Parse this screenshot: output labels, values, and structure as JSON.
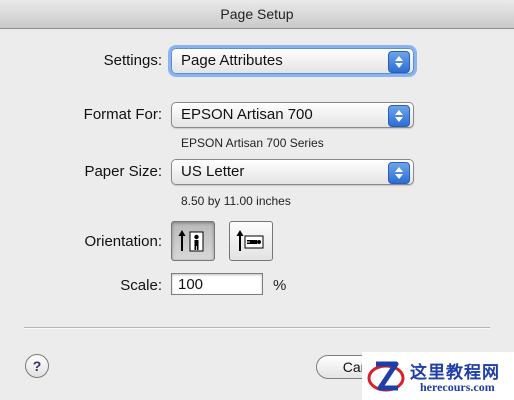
{
  "window": {
    "title": "Page Setup"
  },
  "settings": {
    "label": "Settings:",
    "value": "Page Attributes"
  },
  "format": {
    "label": "Format For:",
    "value": "EPSON Artisan 700",
    "description": "EPSON Artisan 700 Series"
  },
  "paper": {
    "label": "Paper Size:",
    "value": "US Letter",
    "description": "8.50 by 11.00 inches"
  },
  "orientation": {
    "label": "Orientation:",
    "selected": "portrait",
    "options": [
      "portrait-icon",
      "landscape-icon"
    ]
  },
  "scale": {
    "label": "Scale:",
    "value": "100",
    "unit": "%"
  },
  "buttons": {
    "help": "?",
    "cancel": "Cance"
  },
  "watermark": {
    "chinese": "这里教程网",
    "url": "herecours.com"
  },
  "colors": {
    "accent": "#3f82e0",
    "watermark": "#1e3ea8",
    "logo_red": "#d8202a"
  }
}
